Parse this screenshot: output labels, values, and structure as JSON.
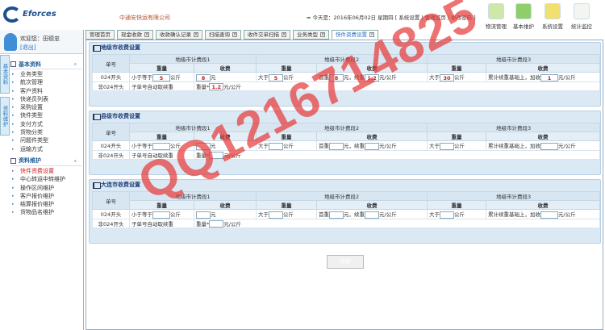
{
  "header": {
    "logo_text": "Eforces",
    "company": "中通安快运有限公司",
    "date_text": "今天是：2016年06月02日 星期四",
    "links": [
      "系统设置",
      "管理首页",
      "修改密码"
    ],
    "top_buttons": [
      {
        "label": "物流管理"
      },
      {
        "label": "基本维护"
      },
      {
        "label": "系统设置"
      },
      {
        "label": "统计监控"
      }
    ]
  },
  "sidebar": {
    "welcome": "欢迎您：田德忠",
    "logout": "[退出]",
    "vtabs": [
      "基本资料",
      "资料维护"
    ],
    "groups": [
      {
        "title": "基本资料",
        "items": [
          "业务类型",
          "航次管理",
          "客户资料",
          "快递员列表",
          "采购设置",
          "快件类型",
          "支付方式",
          "货物分类",
          "问题件类型",
          "运输方式"
        ]
      },
      {
        "title": "资料维护",
        "items": [
          "快件资费设置",
          "中心转运中转维护",
          "操作区间维护",
          "客户报价维护",
          "结算报价维护",
          "货物品名维护"
        ],
        "active": 0
      }
    ]
  },
  "tabs": [
    {
      "label": "管理首页"
    },
    {
      "label": "现金收款"
    },
    {
      "label": "收款确认记录"
    },
    {
      "label": "扫描查询"
    },
    {
      "label": "收件交单扫描"
    },
    {
      "label": "业务类型"
    },
    {
      "label": "快件资费设置",
      "active": true
    }
  ],
  "table_labels": {
    "order": "单号",
    "seg1": "地级市计费段1",
    "seg2": "地级市计费段2",
    "seg3": "地级市计费段3",
    "weight": "重量",
    "fee": "收费",
    "row1": "024开头",
    "row2": "非024开头",
    "less_eq": "小于等于",
    "kg": "公斤",
    "yuan": "元",
    "greater": "大于",
    "first": "首重",
    "cont": "元，续重",
    "per_kg": "元/公斤",
    "extra": "累计续重基础上，加收",
    "auto": "子单号自动取续重",
    "weight_mul": "重量*"
  },
  "sections": [
    {
      "title": "地级市收费设置",
      "v": {
        "w1": "5",
        "f1": "8",
        "w2": "5",
        "first": "8",
        "cont": "1.2",
        "w3": "30",
        "extra": "1",
        "mul": "1.2"
      }
    },
    {
      "title": "县级市收费设置",
      "v": {
        "w1": "",
        "f1": "",
        "w2": "",
        "first": "",
        "cont": "",
        "w3": "",
        "extra": "",
        "mul": ""
      }
    },
    {
      "title": "大连市收费设置",
      "v": {
        "w1": "",
        "f1": "",
        "w2": "",
        "first": "",
        "cont": "",
        "w3": "",
        "extra": "",
        "mul": ""
      }
    }
  ],
  "save_label": "保存",
  "watermark": "QQ1216714825"
}
